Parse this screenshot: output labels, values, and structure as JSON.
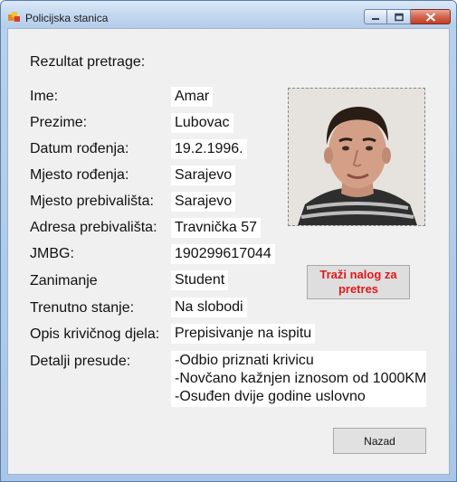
{
  "window": {
    "title": "Policijska stanica",
    "app_icon": "app-icon",
    "controls": [
      "minimize-icon",
      "maximize-icon",
      "close-icon"
    ]
  },
  "form": {
    "heading": "Rezultat pretrage:",
    "fields": [
      {
        "label": "Ime:",
        "value": "Amar"
      },
      {
        "label": "Prezime:",
        "value": "Lubovac"
      },
      {
        "label": "Datum rođenja:",
        "value": "19.2.1996."
      },
      {
        "label": "Mjesto rođenja:",
        "value": "Sarajevo"
      },
      {
        "label": "Mjesto prebivališta:",
        "value": "Sarajevo"
      },
      {
        "label": "Adresa prebivališta:",
        "value": "Travnička 57"
      },
      {
        "label": "JMBG:",
        "value": "190299617044"
      },
      {
        "label": "Zanimanje",
        "value": "Student"
      },
      {
        "label": "Trenutno stanje:",
        "value": "Na slobodi"
      },
      {
        "label": "Opis krivičnog djela:",
        "value": "Prepisivanje na ispitu"
      }
    ],
    "details": {
      "label": "Detalji presude:",
      "lines": [
        "-Odbio priznati krivicu",
        "-Novčano kažnjen iznosom od 1000KM",
        "-Osuđen dvije godine uslovno"
      ]
    }
  },
  "buttons": {
    "warrant": "Traži nalog za pretres",
    "back": "Nazad"
  },
  "colors": {
    "warrant_text": "#e0191b",
    "client_bg": "#f0f0f0"
  }
}
